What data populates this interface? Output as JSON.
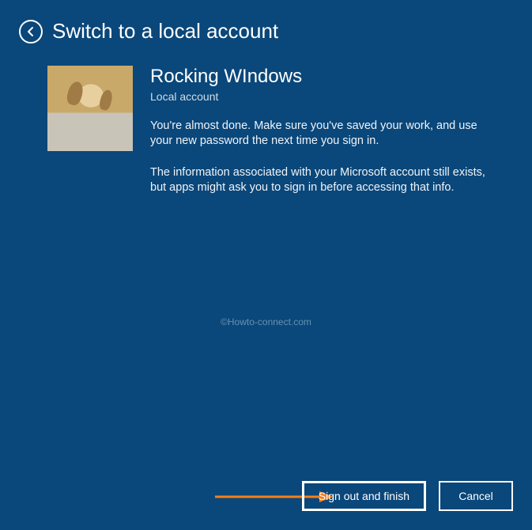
{
  "header": {
    "title": "Switch to a local account"
  },
  "user": {
    "name": "Rocking WIndows",
    "accountType": "Local account"
  },
  "body": {
    "para1": "You're almost done. Make sure you've saved your work, and use your new password the next time you sign in.",
    "para2": "The information associated with your Microsoft account still exists, but apps might ask you to sign in before accessing that info."
  },
  "buttons": {
    "primary": "Sign out and finish",
    "cancel": "Cancel"
  },
  "watermark": "©Howto-connect.com",
  "colors": {
    "background": "#0a477a",
    "annotation": "#f77f1b"
  }
}
